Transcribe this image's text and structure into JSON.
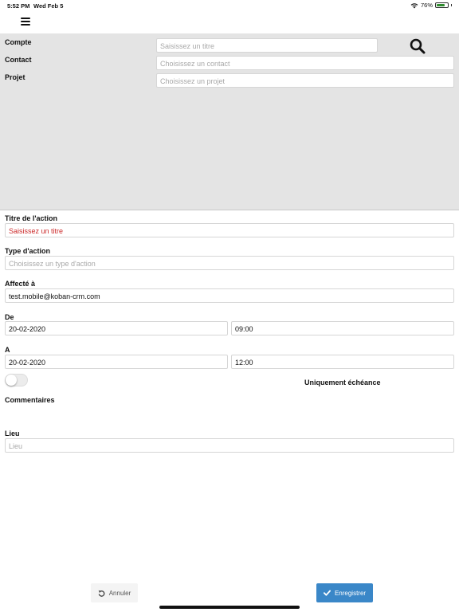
{
  "status_bar": {
    "time": "5:52 PM",
    "date": "Wed Feb 5",
    "battery": "76%",
    "battery_level": 0.76,
    "icons": [
      "wifi-icon",
      "battery-icon"
    ]
  },
  "nav": {
    "menu_icon": "hamburger-menu-icon"
  },
  "search_panel": {
    "compte_label": "Compte",
    "compte_placeholder": "Saisissez un titre",
    "contact_label": "Contact",
    "contact_placeholder": "Choisissez un contact",
    "projet_label": "Projet",
    "projet_placeholder": "Choisissez un projet",
    "search_icon": "search-icon"
  },
  "form": {
    "titre_label": "Titre de l'action",
    "titre_placeholder": "Saisissez un titre",
    "type_label": "Type d'action",
    "type_placeholder": "Choisissez un type d'action",
    "affecte_label": "Affecté à",
    "affecte_value": "test.mobile@koban-crm.com",
    "de_label": "De",
    "de_date": "20-02-2020",
    "de_time": "09:00",
    "a_label": "A",
    "a_date": "20-02-2020",
    "a_time": "12:00",
    "uniquement_label": "Uniquement échéance",
    "uniquement_on": false,
    "commentaires_label": "Commentaires",
    "lieu_label": "Lieu",
    "lieu_placeholder": "Lieu"
  },
  "actions": {
    "cancel_label": "Annuler",
    "cancel_icon": "undo-icon",
    "save_label": "Enregistrer",
    "save_icon": "check-icon",
    "save_color": "#3a87c8"
  }
}
